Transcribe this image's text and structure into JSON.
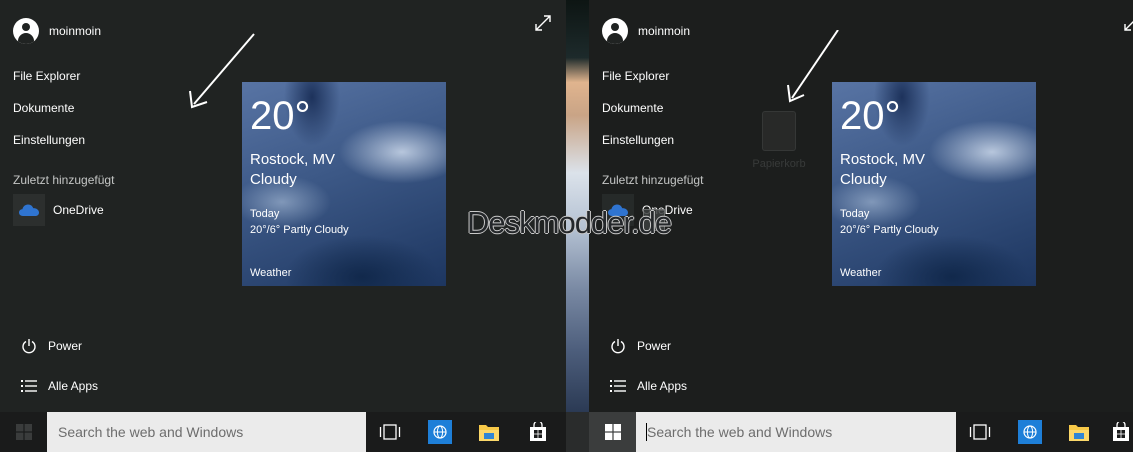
{
  "left_panel": {
    "username": "moinmoin",
    "links": [
      "File Explorer",
      "Dokumente",
      "Einstellungen"
    ],
    "recent_label": "Zuletzt hinzugefügt",
    "recent_app": "OneDrive",
    "power_label": "Power",
    "all_apps_label": "Alle Apps"
  },
  "right_panel": {
    "username": "moinmoin",
    "links": [
      "File Explorer",
      "Dokumente",
      "Einstellungen"
    ],
    "recent_label": "Zuletzt hinzugefügt",
    "recent_app": "OneDrive",
    "power_label": "Power",
    "all_apps_label": "Alle Apps",
    "desktop_icon_label": "Papierkorb"
  },
  "weather_tile": {
    "temperature": "20°",
    "city": "Rostock, MV",
    "condition": "Cloudy",
    "day": "Today",
    "forecast": "20°/6° Partly Cloudy",
    "tile_name": "Weather"
  },
  "watermark": "Deskmodder.de",
  "taskbar": {
    "search_placeholder": "Search the web and Windows",
    "icons": [
      "task-view-icon",
      "ie-browser-icon",
      "file-explorer-icon",
      "store-icon"
    ]
  },
  "colors": {
    "start_bg": "#202322",
    "taskbar_bg": "#1a1b1b",
    "search_bg": "#ebebeb",
    "accent_blue": "#1e7fd8",
    "folder_yellow": "#f7c948"
  }
}
